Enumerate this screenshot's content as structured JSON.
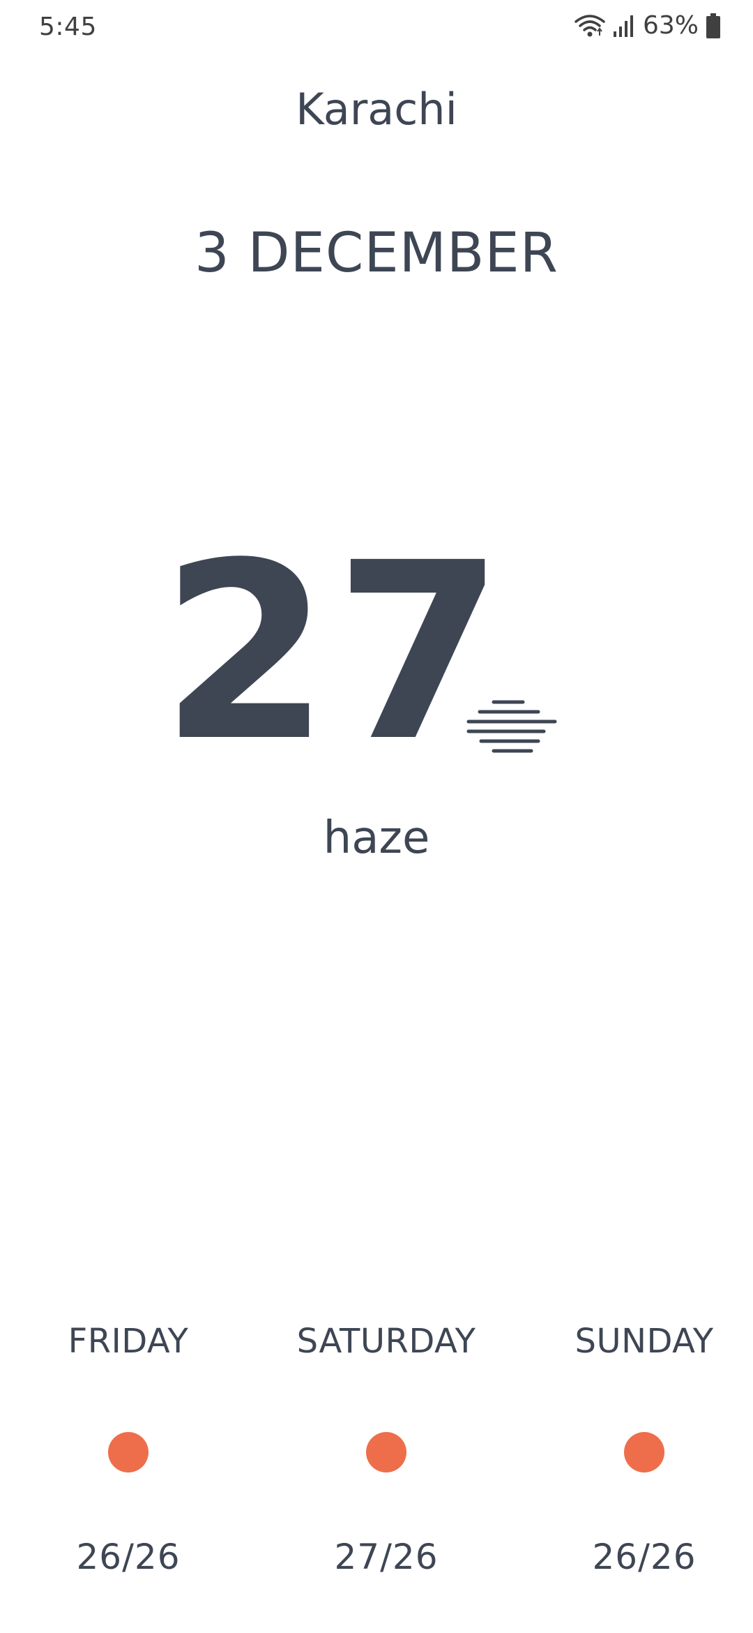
{
  "status_bar": {
    "time": "5:45",
    "battery_text": "63%",
    "icons": [
      "wifi-icon",
      "signal-icon",
      "battery-icon"
    ]
  },
  "location": {
    "city": "Karachi"
  },
  "date": "3 DECEMBER",
  "current": {
    "temperature": "27",
    "condition": "haze",
    "icon": "haze-icon"
  },
  "forecast": [
    {
      "day": "FRIDAY",
      "temps": "26/26",
      "icon": "sun-dot-icon"
    },
    {
      "day": "SATURDAY",
      "temps": "27/26",
      "icon": "sun-dot-icon"
    },
    {
      "day": "SUNDAY",
      "temps": "26/26",
      "icon": "sun-dot-icon"
    }
  ],
  "colors": {
    "text": "#3e4654",
    "accent_dot": "#ee6e4b",
    "background": "#ffffff"
  }
}
